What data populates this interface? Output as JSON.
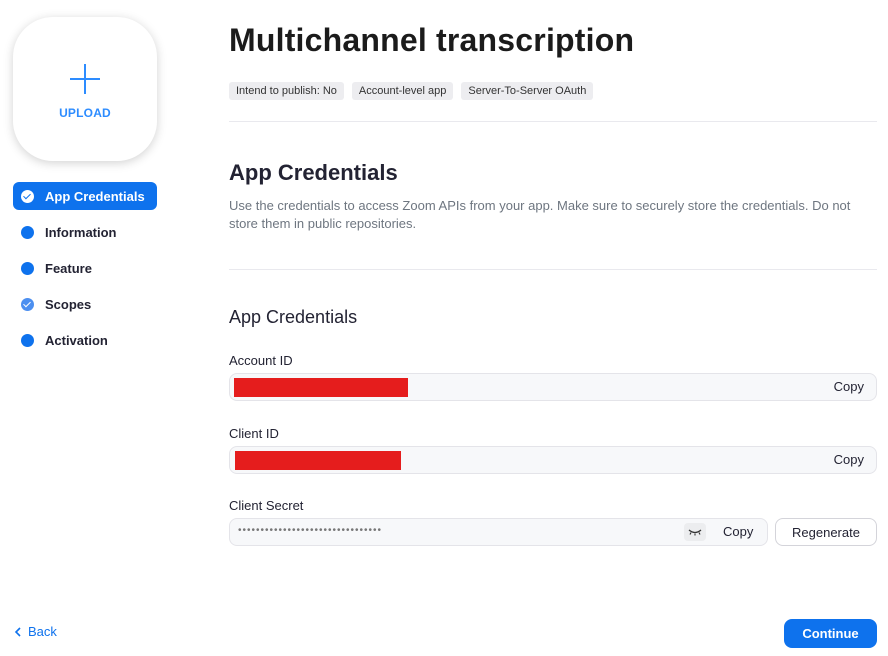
{
  "upload": {
    "label": "UPLOAD",
    "icon": "plus-icon"
  },
  "nav": {
    "items": [
      {
        "label": "App Credentials",
        "active": true,
        "icon": "check-circle-icon"
      },
      {
        "label": "Information",
        "active": false,
        "icon": "dot-icon"
      },
      {
        "label": "Feature",
        "active": false,
        "icon": "dot-icon"
      },
      {
        "label": "Scopes",
        "active": false,
        "icon": "check-circle-icon"
      },
      {
        "label": "Activation",
        "active": false,
        "icon": "dot-icon"
      }
    ]
  },
  "header": {
    "title": "Multichannel transcription",
    "tags": [
      "Intend to publish: No",
      "Account-level app",
      "Server-To-Server OAuth"
    ]
  },
  "section": {
    "title": "App Credentials",
    "description": "Use the credentials to access Zoom APIs from your app. Make sure to securely store the credentials. Do not store them in public repositories."
  },
  "credentials": {
    "title": "App Credentials",
    "account_id": {
      "label": "Account ID",
      "copy_label": "Copy"
    },
    "client_id": {
      "label": "Client ID",
      "copy_label": "Copy"
    },
    "client_secret": {
      "label": "Client Secret",
      "masked_value": "••••••••••••••••••••••••••••••••",
      "copy_label": "Copy",
      "regenerate_label": "Regenerate",
      "toggle_icon": "eye-closed-icon"
    }
  },
  "footer": {
    "back_label": "Back",
    "continue_label": "Continue"
  },
  "colors": {
    "accent": "#0E72ED",
    "upload_blue": "#2D8CFF",
    "redaction": "#E51D1D"
  }
}
